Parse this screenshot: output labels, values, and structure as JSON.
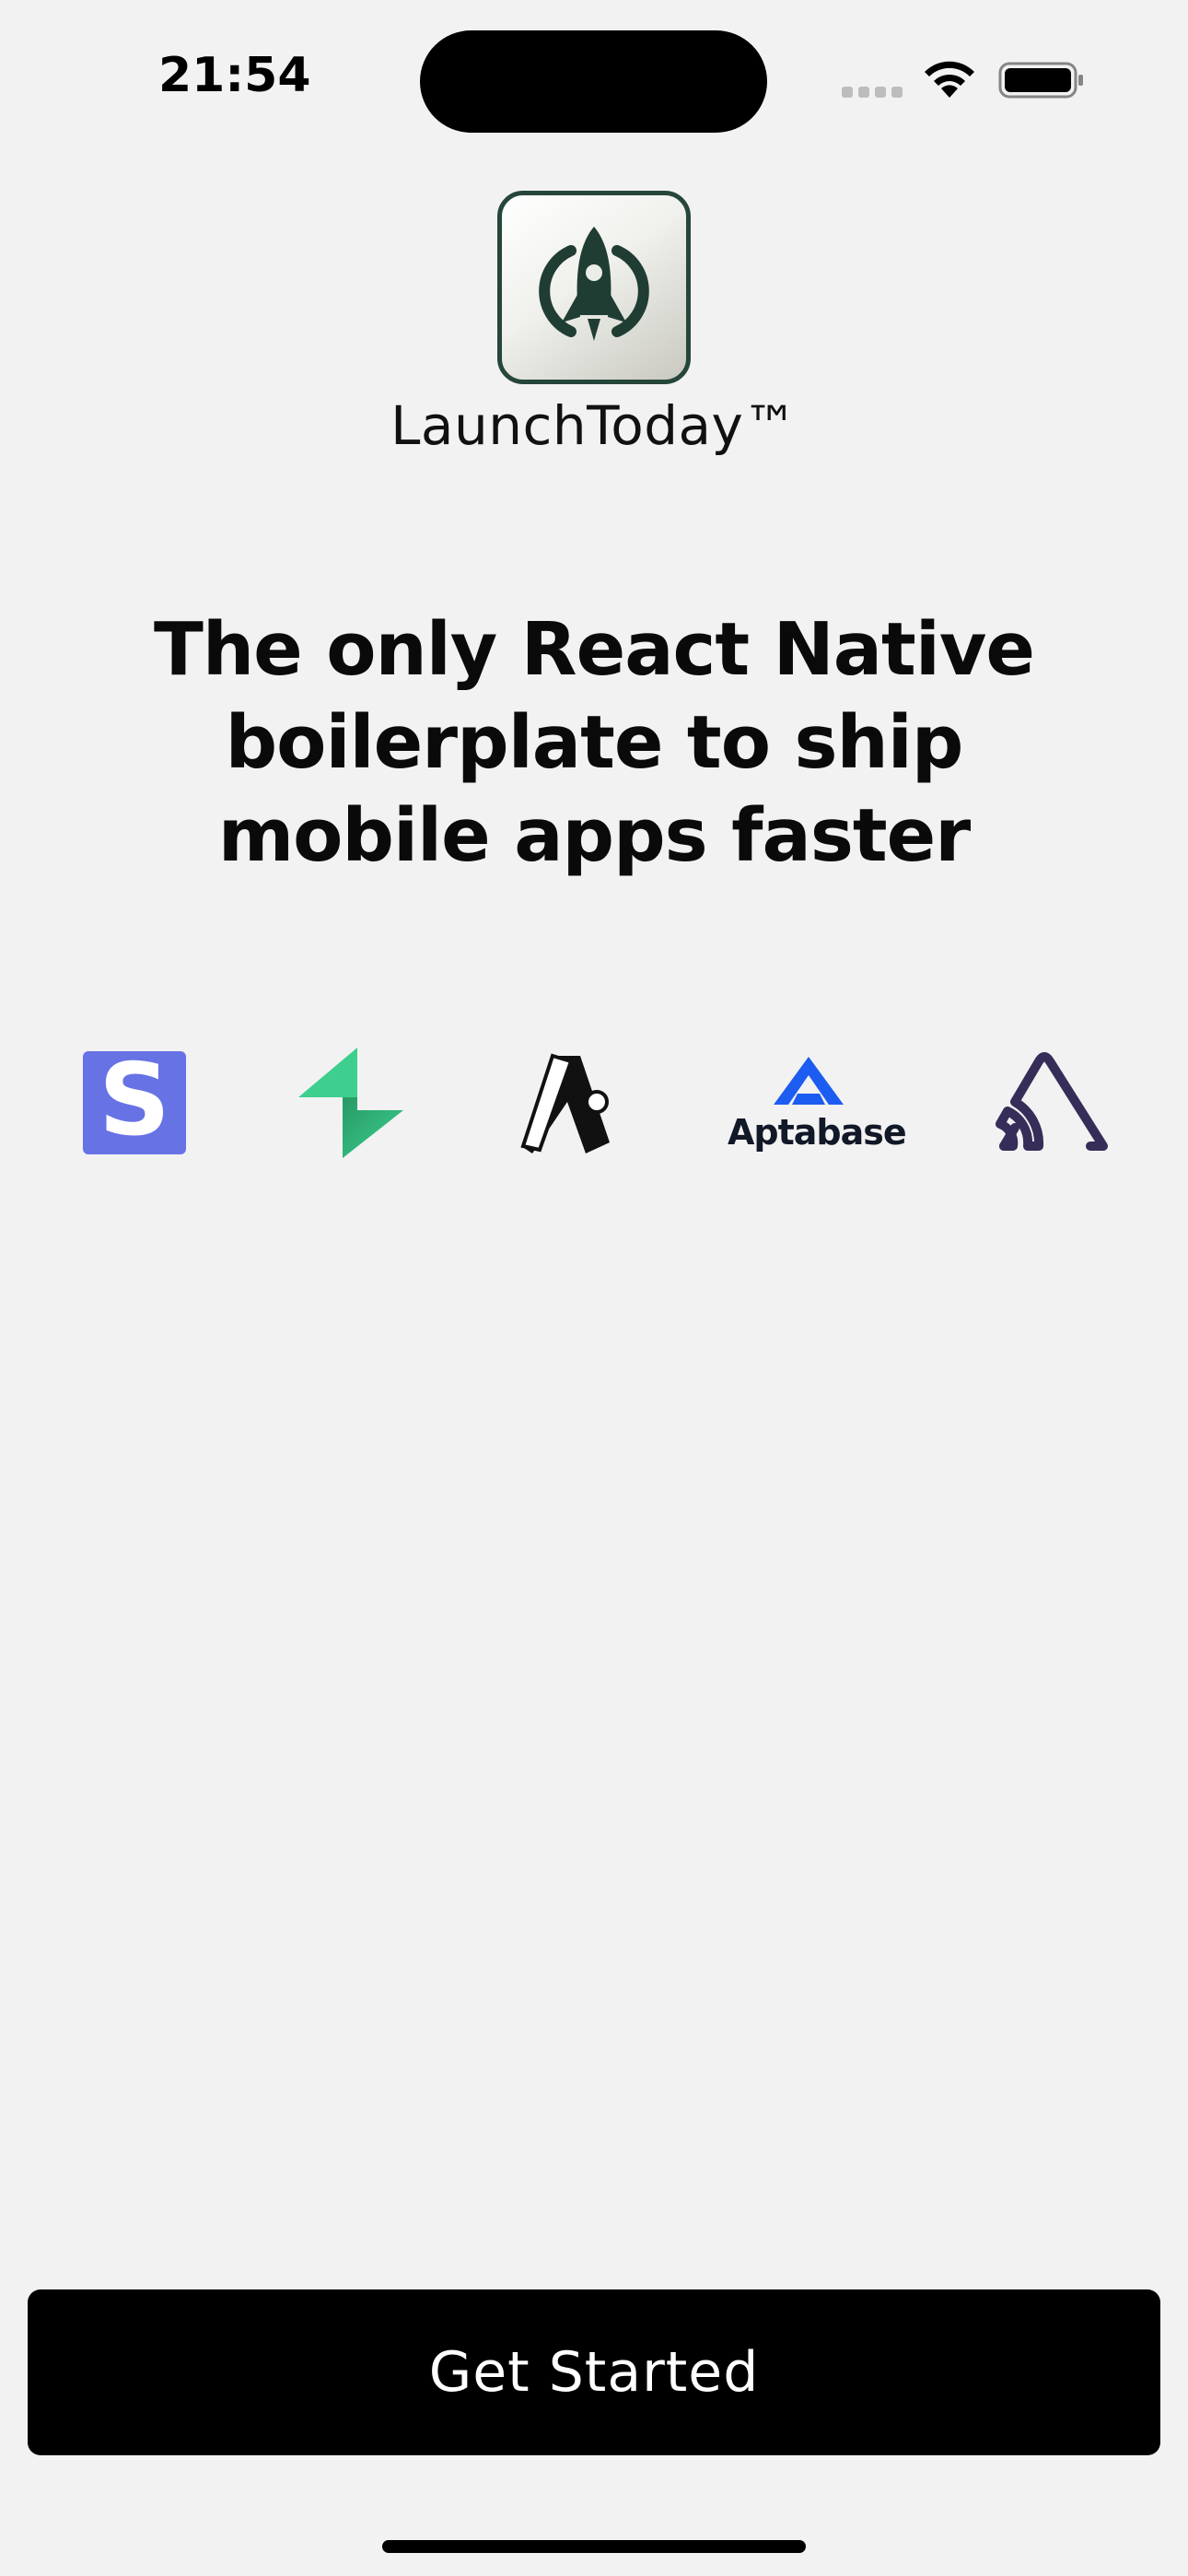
{
  "status_bar": {
    "time": "21:54"
  },
  "app": {
    "name": "LaunchToday™",
    "logo_icon": "rocket-icon"
  },
  "headline": {
    "line1": "The only React Native",
    "line2": "boilerplate to ship",
    "line3": "mobile apps faster"
  },
  "partners": {
    "items": [
      {
        "icon": "stripe-logo",
        "glyph": "S",
        "color": "#6772e5"
      },
      {
        "icon": "supabase-logo",
        "color": "#3ecf8e"
      },
      {
        "icon": "revenuecat-logo",
        "color": "#111111"
      },
      {
        "icon": "aptabase-logo",
        "label": "Aptabase",
        "color": "#1d5cf0"
      },
      {
        "icon": "sentry-logo",
        "color": "#362d59"
      }
    ]
  },
  "cta": {
    "label": "Get Started"
  },
  "colors": {
    "background": "#f2f2f2",
    "button": "#000000",
    "button_text": "#ffffff",
    "logo_border": "#26463a"
  }
}
